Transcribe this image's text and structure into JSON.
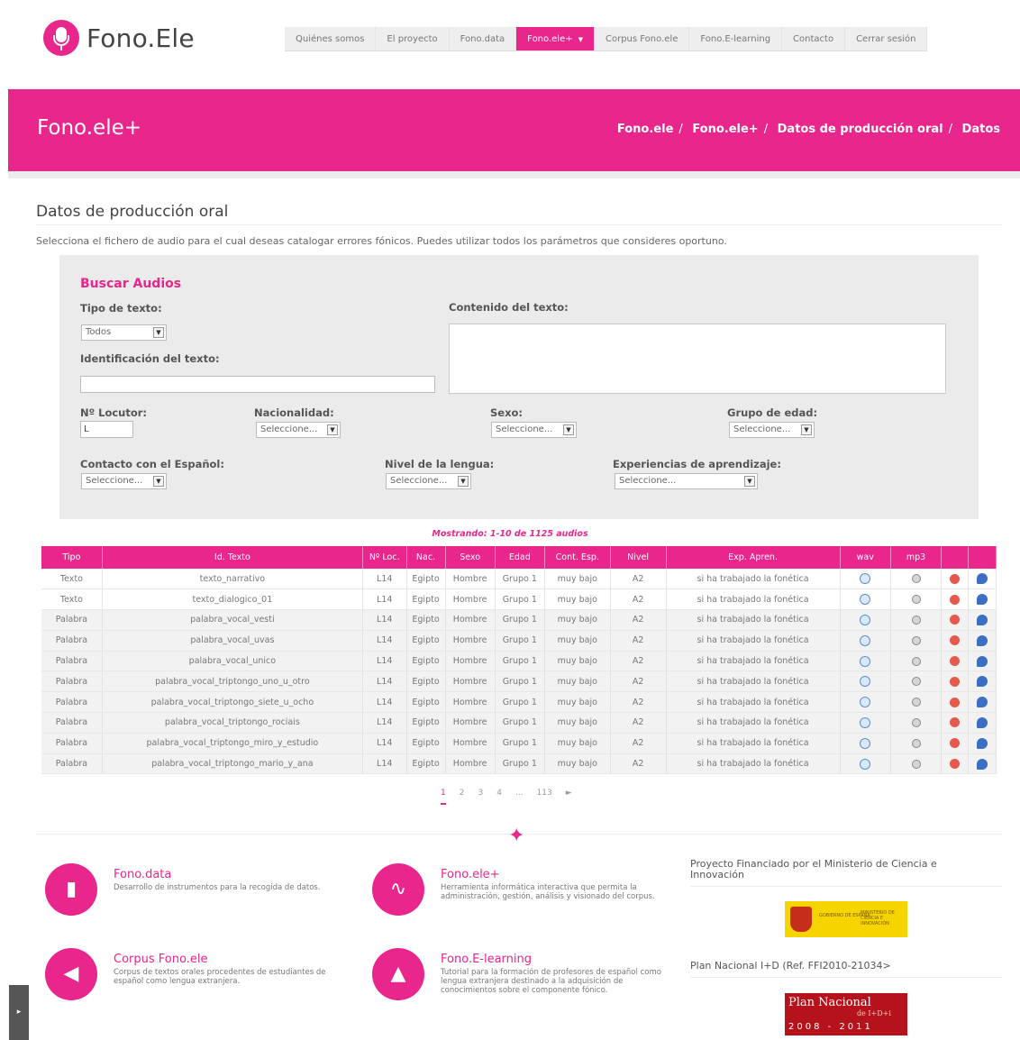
{
  "brand": {
    "name": "Fono.Ele"
  },
  "nav": [
    {
      "label": "Quiénes somos",
      "active": false
    },
    {
      "label": "El proyecto",
      "active": false
    },
    {
      "label": "Fono.data",
      "active": false
    },
    {
      "label": "Fono.ele+",
      "active": true
    },
    {
      "label": "Corpus Fono.ele",
      "active": false
    },
    {
      "label": "Fono.E-learning",
      "active": false
    },
    {
      "label": "Contacto",
      "active": false
    },
    {
      "label": "Cerrar sesión",
      "active": false
    }
  ],
  "banner": {
    "title": "Fono.ele+",
    "breadcrumb": [
      "Fono.ele",
      "Fono.ele+",
      "Datos de producción oral",
      "Datos"
    ]
  },
  "section": {
    "title": "Datos de producción oral",
    "description": "Selecciona el fichero de audio para el cual deseas catalogar errores fónicos. Puedes utilizar todos los parámetros que consideres oportuno."
  },
  "search": {
    "title": "Buscar Audios",
    "tipo_texto_label": "Tipo de texto:",
    "tipo_texto_value": "Todos",
    "contenido_label": "Contenido del texto:",
    "identificacion_label": "Identificación del texto:",
    "locutor_label": "Nº Locutor:",
    "locutor_value": "L",
    "nacionalidad_label": "Nacionalidad:",
    "nacionalidad_value": "Seleccione...",
    "sexo_label": "Sexo:",
    "sexo_value": "Seleccione...",
    "grupo_label": "Grupo de edad:",
    "grupo_value": "Seleccione...",
    "contacto_label": "Contacto con el Español:",
    "contacto_value": "Seleccione...",
    "nivel_label": "Nivel de la lengua:",
    "nivel_value": "Seleccione...",
    "experiencias_label": "Experiencias de aprendizaje:",
    "experiencias_value": "Seleccione..."
  },
  "results": {
    "showing": "Mostrando: 1-10 de 1125 audios",
    "headers": [
      "Tipo",
      "Id. Texto",
      "Nº Loc.",
      "Nac.",
      "Sexo",
      "Edad",
      "Cont. Esp.",
      "Nivel",
      "Exp. Apren.",
      "wav",
      "mp3",
      "",
      ""
    ],
    "rows": [
      [
        "Texto",
        "texto_narrativo",
        "L14",
        "Egipto",
        "Hombre",
        "Grupo 1",
        "muy bajo",
        "A2",
        "si ha trabajado la fonética"
      ],
      [
        "Texto",
        "texto_dialogico_01",
        "L14",
        "Egipto",
        "Hombre",
        "Grupo 1",
        "muy bajo",
        "A2",
        "si ha trabajado la fonética"
      ],
      [
        "Palabra",
        "palabra_vocal_vesti",
        "L14",
        "Egipto",
        "Hombre",
        "Grupo 1",
        "muy bajo",
        "A2",
        "si ha trabajado la fonética"
      ],
      [
        "Palabra",
        "palabra_vocal_uvas",
        "L14",
        "Egipto",
        "Hombre",
        "Grupo 1",
        "muy bajo",
        "A2",
        "si ha trabajado la fonética"
      ],
      [
        "Palabra",
        "palabra_vocal_unico",
        "L14",
        "Egipto",
        "Hombre",
        "Grupo 1",
        "muy bajo",
        "A2",
        "si ha trabajado la fonética"
      ],
      [
        "Palabra",
        "palabra_vocal_triptongo_uno_u_otro",
        "L14",
        "Egipto",
        "Hombre",
        "Grupo 1",
        "muy bajo",
        "A2",
        "si ha trabajado la fonética"
      ],
      [
        "Palabra",
        "palabra_vocal_triptongo_siete_u_ocho",
        "L14",
        "Egipto",
        "Hombre",
        "Grupo 1",
        "muy bajo",
        "A2",
        "si ha trabajado la fonética"
      ],
      [
        "Palabra",
        "palabra_vocal_triptongo_rociais",
        "L14",
        "Egipto",
        "Hombre",
        "Grupo 1",
        "muy bajo",
        "A2",
        "si ha trabajado la fonética"
      ],
      [
        "Palabra",
        "palabra_vocal_triptongo_miro_y_estudio",
        "L14",
        "Egipto",
        "Hombre",
        "Grupo 1",
        "muy bajo",
        "A2",
        "si ha trabajado la fonética"
      ],
      [
        "Palabra",
        "palabra_vocal_triptongo_mario_y_ana",
        "L14",
        "Egipto",
        "Hombre",
        "Grupo 1",
        "muy bajo",
        "A2",
        "si ha trabajado la fonética"
      ]
    ]
  },
  "pagination": [
    "1",
    "2",
    "3",
    "4",
    "...",
    "113",
    "►"
  ],
  "footer": {
    "features": [
      {
        "title": "Fono.data",
        "desc": "Desarrollo de instrumentos para la recogida de datos.",
        "icon": "usb-drive-icon"
      },
      {
        "title": "Fono.ele+",
        "desc": "Herramienta informática interactiva que permita la administración, gestión, análisis y visionado del corpus.",
        "icon": "waveform-icon"
      },
      {
        "title": "Corpus Fono.ele",
        "desc": "Corpus de textos orales procedentes de estudiantes de español como lengua extranjera.",
        "icon": "speaker-icon"
      },
      {
        "title": "Fono.E-learning",
        "desc": "Tutorial para la formación de profesores de español como lengua extranjera destinado a la adquisición de conocimientos sobre el componente fónico.",
        "icon": "graduation-cap-icon"
      }
    ],
    "funding_text": "Proyecto Financiado por el Ministerio de Ciencia e Innovación",
    "gov_logo_left": "GOBIERNO DE ESPAÑA",
    "gov_logo_right": "MINISTERIO DE CIENCIA E INNOVACIÓN",
    "plan_text": "Plan Nacional I+D (Ref. FFI2010-21034>",
    "plan_logo_title": "Plan Nacional",
    "plan_logo_sub": "de I+D+i",
    "plan_logo_years": "2008 - 2011"
  },
  "colors": {
    "accent": "#e9268b",
    "panel": "#ebebeb"
  }
}
